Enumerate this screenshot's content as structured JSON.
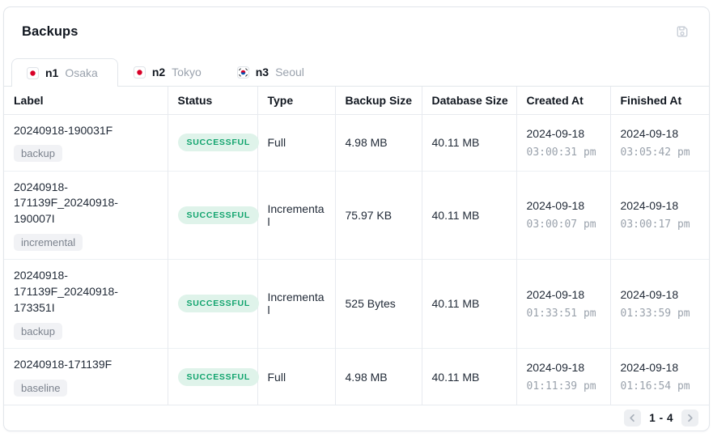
{
  "header": {
    "title": "Backups"
  },
  "tabs": [
    {
      "node": "n1",
      "city": "Osaka",
      "flag": "japan",
      "active": true
    },
    {
      "node": "n2",
      "city": "Tokyo",
      "flag": "japan",
      "active": false
    },
    {
      "node": "n3",
      "city": "Seoul",
      "flag": "south-korea",
      "active": false
    }
  ],
  "table": {
    "columns": [
      "Label",
      "Status",
      "Type",
      "Backup Size",
      "Database Size",
      "Created At",
      "Finished At"
    ],
    "rows": [
      {
        "label": "20240918-190031F",
        "tag": "backup",
        "status": "SUCCESSFUL",
        "type": "Full",
        "backup_size": "4.98 MB",
        "database_size": "40.11 MB",
        "created_date": "2024-09-18",
        "created_time": "03:00:31 pm",
        "finished_date": "2024-09-18",
        "finished_time": "03:05:42 pm"
      },
      {
        "label": "20240918-171139F_20240918-190007I",
        "tag": "incremental",
        "status": "SUCCESSFUL",
        "type": "Incremental",
        "backup_size": "75.97 KB",
        "database_size": "40.11 MB",
        "created_date": "2024-09-18",
        "created_time": "03:00:07 pm",
        "finished_date": "2024-09-18",
        "finished_time": "03:00:17 pm"
      },
      {
        "label": "20240918-171139F_20240918-173351I",
        "tag": "backup",
        "status": "SUCCESSFUL",
        "type": "Incremental",
        "backup_size": "525 Bytes",
        "database_size": "40.11 MB",
        "created_date": "2024-09-18",
        "created_time": "01:33:51 pm",
        "finished_date": "2024-09-18",
        "finished_time": "01:33:59 pm"
      },
      {
        "label": "20240918-171139F",
        "tag": "baseline",
        "status": "SUCCESSFUL",
        "type": "Full",
        "backup_size": "4.98 MB",
        "database_size": "40.11 MB",
        "created_date": "2024-09-18",
        "created_time": "01:11:39 pm",
        "finished_date": "2024-09-18",
        "finished_time": "01:16:54 pm"
      }
    ]
  },
  "pagination": {
    "range": "1 - 4"
  },
  "colors": {
    "status_success_bg": "#dff3ea",
    "status_success_text": "#12a46e",
    "border": "#e7eaef",
    "flag_red": "#d80027",
    "flag_blue": "#0052b4",
    "muted_text": "#9aa2ac"
  }
}
